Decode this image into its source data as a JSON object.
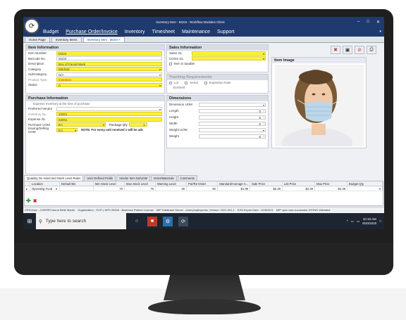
{
  "window": {
    "title": "Inventory Item - M104 - Workflow Modules Client",
    "min": "–",
    "max": "□",
    "close": "✕"
  },
  "menu": {
    "items": [
      "Budget",
      "Purchase Order/Invoice",
      "Inventory",
      "Timesheet",
      "Maintenance",
      "Support"
    ],
    "active": "Purchase Order/Invoice"
  },
  "doctabs": [
    "Home Page",
    "Inventory Items",
    "Inventory Item : M104 ×"
  ],
  "item_info": {
    "header": "Item Information",
    "fields": [
      {
        "label": "Item Number",
        "value": "M104",
        "style": "y"
      },
      {
        "label": "Barcode No.",
        "value": "M104",
        "style": ""
      },
      {
        "label": "Description",
        "value": "Box of Facial Mask",
        "style": "y"
      },
      {
        "label": "Category",
        "value": "Medical",
        "style": "y dd"
      },
      {
        "label": "SubCategory",
        "value": "N/A",
        "style": "dd"
      },
      {
        "label": "Product Type",
        "value": "Inventory",
        "style": "y red",
        "muted": true
      },
      {
        "label": "Status",
        "value": "A",
        "style": "y dd"
      }
    ]
  },
  "purchase_info": {
    "header": "Purchase Information",
    "note": "Expense Inventory at the time of purchase",
    "preferred_vendor_label": "Preferred Vendor",
    "preferred_vendor": "",
    "inventory_gl_label": "Inventory GL",
    "inventory_gl": "10001",
    "expense_gl_label": "Expense GL",
    "expense_gl": "63001",
    "purchase_uom_label": "Purchase UOM",
    "purchase_uom": "EA",
    "package_qty_label": "Package Qty",
    "package_qty": "1",
    "issuing_uom_label": "Issuing/Selling UOM",
    "issuing_uom": "EA",
    "issuing_note": "NOTE: For every unit received 1 will be adc"
  },
  "sales_info": {
    "header": "Sales Information",
    "sales_gl_label": "Sales GL",
    "cogs_gl_label": "COGS GL",
    "taxable_label": "Item is taxable"
  },
  "tracking": {
    "header": "Tracking Requirements",
    "options": [
      "Lot",
      "Serial",
      "Expiration Date"
    ],
    "sn_shelf": "Sn/Shelf"
  },
  "dimensions": {
    "header": "Dimensions",
    "rows": [
      {
        "label": "Dimension UOM",
        "value": "",
        "type": "dd"
      },
      {
        "label": "Length",
        "value": "0",
        "type": "spin"
      },
      {
        "label": "Height",
        "value": "0",
        "type": "spin"
      },
      {
        "label": "Width",
        "value": "0",
        "type": "spin"
      },
      {
        "label": "Weight UOM",
        "value": "",
        "type": "dd"
      },
      {
        "label": "Weight",
        "value": "0",
        "type": "spin"
      }
    ]
  },
  "item_image": {
    "header": "Item Image"
  },
  "toolbar_icons": [
    "delete-image-icon",
    "save-icon",
    "delete-icon",
    "print-icon"
  ],
  "bottom_tabs": [
    "Quantity On Hand and Stock Level Rules",
    "User Defined Fields",
    "Vendor Item No/UOM",
    "Items/Materials",
    "Comments"
  ],
  "grid": {
    "columns": [
      "",
      "Location",
      "Default Bin",
      "Min Stock Level",
      "Max Stock Level",
      "Warning Level",
      "Par/Re-Order",
      "Standard/Average C...",
      "Sale Price",
      "List Price",
      "Max Price",
      "Budget Qty"
    ],
    "rows": [
      [
        "▸",
        "Operating Fund",
        "",
        "70",
        "75",
        "45",
        "60",
        "$1.99",
        "$2.49",
        "$2.49",
        "$2.49",
        "0"
      ]
    ]
  },
  "status": {
    "user": "CPU\\User - CHERRY\\Anna Belle Martin",
    "org": "Organization - 0137 | NPS 00005 - Business Partner License",
    "db": "MIP Database Server - cherry\\sqlexpress, Version: 2021.001.1",
    "expire": "EJM Expire Date : 10/8/2021",
    "sync": "MIP sync was successful JHONS Validated"
  },
  "taskbar": {
    "search_placeholder": "Type here to search",
    "time": "10:19 AM",
    "date": "8/20/2020"
  }
}
